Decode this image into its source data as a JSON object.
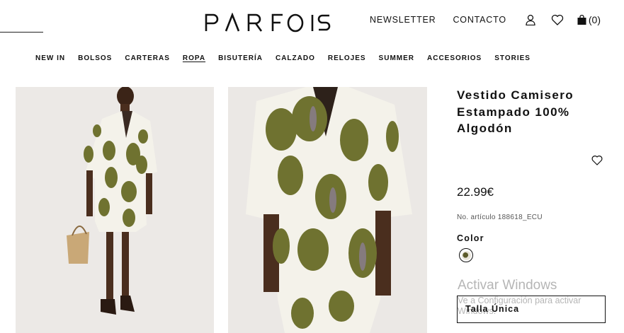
{
  "brand": {
    "logo_text": "PARFOIS"
  },
  "top_bar": {
    "newsletter": "NEWSLETTER",
    "contact": "CONTACTO",
    "bag_count": "(0)"
  },
  "nav": {
    "items": [
      {
        "label": "NEW IN",
        "active": false
      },
      {
        "label": "BOLSOS",
        "active": false
      },
      {
        "label": "CARTERAS",
        "active": false
      },
      {
        "label": "ROPA",
        "active": true
      },
      {
        "label": "BISUTERÍA",
        "active": false
      },
      {
        "label": "CALZADO",
        "active": false
      },
      {
        "label": "RELOJES",
        "active": false
      },
      {
        "label": "SUMMER",
        "active": false
      },
      {
        "label": "ACCESORIOS",
        "active": false
      },
      {
        "label": "STORIES",
        "active": false
      }
    ]
  },
  "product": {
    "title": "Vestido Camisero Estampado 100% Algodón",
    "price": "22.99€",
    "sku": "No. artículo 188618_ECU",
    "color_label": "Color",
    "size": "Talla Única"
  },
  "watermark": {
    "title": "Activar Windows",
    "subtitle": "Ve a Configuración para activar Windows."
  },
  "colors": {
    "dress_print": "#6f7230",
    "dress_base": "#f4f2ea",
    "skin": "#4a2e1e"
  }
}
